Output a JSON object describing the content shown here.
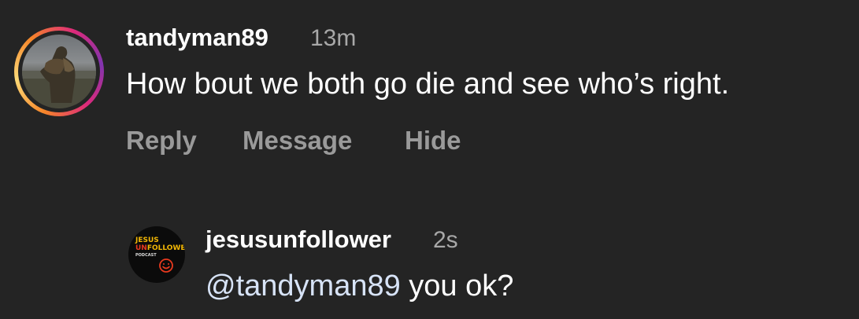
{
  "top_comment": {
    "username": "tandyman89",
    "time": "13m",
    "text": "How bout we both go die and see who’s right.",
    "actions": {
      "reply": "Reply",
      "message": "Message",
      "hide": "Hide"
    },
    "story_ring_colors": [
      "#f58529",
      "#feda77",
      "#dd2a7b",
      "#8134af"
    ]
  },
  "reply": {
    "username": "jesusunfollower",
    "time": "2s",
    "mention": "@tandyman89",
    "text": " you ok?",
    "avatar_logo": {
      "line1": "JESUS",
      "line2_prefix": "UN",
      "line2_rest": "FOLLOWER",
      "line3": "PODCAST",
      "accent_color": "#e8391e",
      "icon": "smiley-icon"
    }
  },
  "colors": {
    "background": "#242424",
    "primary_text": "#ffffff",
    "secondary_text": "#a8a8a8",
    "action_text": "#9a9a9a",
    "mention": "#d7e3f7"
  }
}
